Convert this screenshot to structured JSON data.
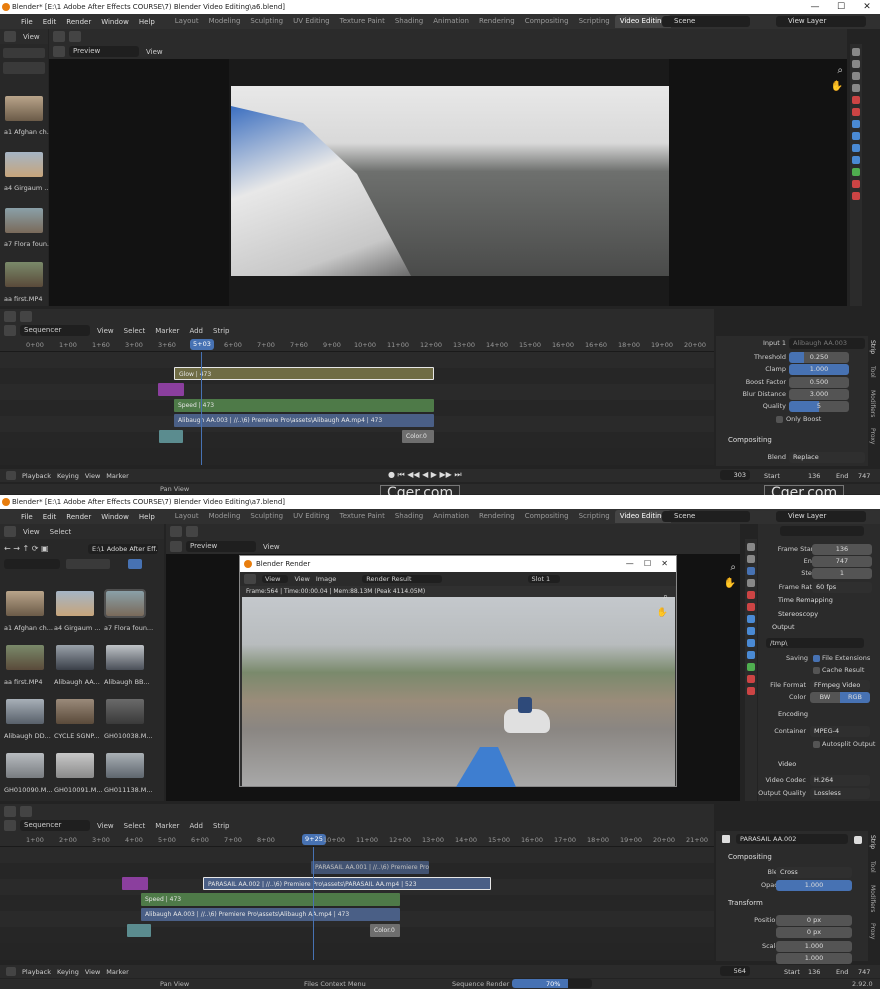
{
  "top": {
    "title": "Blender* [E:\\1 Adobe After Effects COURSE\\7) Blender Video Editing\\a6.blend]",
    "menus": [
      "File",
      "Edit",
      "Render",
      "Window",
      "Help"
    ],
    "workspaces": [
      "Layout",
      "Modeling",
      "Sculpting",
      "UV Editing",
      "Texture Paint",
      "Shading",
      "Animation",
      "Rendering",
      "Compositing",
      "Scripting",
      "Video Editing"
    ],
    "scene": "Scene",
    "view_layer": "View Layer",
    "browser_view": "View",
    "preview_mode": "Preview",
    "preview_view": "View",
    "files": [
      {
        "name": "a1 Afghan ch..."
      },
      {
        "name": "a4 Girgaum ..."
      },
      {
        "name": "a7 Flora foun..."
      },
      {
        "name": "aa first.MP4"
      }
    ],
    "seq_label": "Sequencer",
    "seq_menus": [
      "View",
      "Select",
      "Marker",
      "Add",
      "Strip"
    ],
    "ticks": [
      "0+00",
      "1+00",
      "1+60",
      "3+00",
      "3+60",
      "5+03",
      "6+00",
      "7+00",
      "7+60",
      "9+00",
      "10+00",
      "11+00",
      "12+00",
      "13+00",
      "14+00",
      "15+00",
      "16+00",
      "16+60",
      "18+00",
      "19+00",
      "20+00"
    ],
    "current_frame_label": "5+03",
    "strips": {
      "glow": "Glow | 473",
      "speed": "Speed | 473",
      "video": "Alibaugh AA.003 | //..\\6) Premiere Pro\\assets\\Alibaugh AA.mp4 | 473",
      "color": "Color.0"
    },
    "props": {
      "input_label": "Input 1",
      "input_value": "Alibaugh AA.003",
      "rows": [
        {
          "label": "Threshold",
          "value": "0.250"
        },
        {
          "label": "Clamp",
          "value": "1.000"
        },
        {
          "label": "Boost Factor",
          "value": "0.500"
        },
        {
          "label": "Blur Distance",
          "value": "3.000"
        },
        {
          "label": "Quality",
          "value": "5"
        }
      ],
      "only_boost": "Only Boost",
      "compositing": "Compositing",
      "blend_label": "Blend",
      "blend_value": "Replace"
    },
    "tabs": [
      "Strip",
      "Tool",
      "Modifiers",
      "Proxy"
    ],
    "footer": {
      "playback": "Playback",
      "keying": "Keying",
      "view": "View",
      "marker": "Marker",
      "frame": "303",
      "start_label": "Start",
      "start": "136",
      "end_label": "End",
      "end": "747"
    },
    "status": {
      "left": "Pan View"
    }
  },
  "watermark": "Cger.com",
  "bottom": {
    "title": "Blender* [E:\\1 Adobe After Effects COURSE\\7) Blender Video Editing\\a7.blend]",
    "menus": [
      "File",
      "Edit",
      "Render",
      "Window",
      "Help"
    ],
    "workspaces": [
      "Layout",
      "Modeling",
      "Sculpting",
      "UV Editing",
      "Texture Paint",
      "Shading",
      "Animation",
      "Rendering",
      "Compositing",
      "Scripting",
      "Video Editing"
    ],
    "scene": "Scene",
    "view_layer": "View Layer",
    "browser_view": "View",
    "browser_select": "Select",
    "path": "E:\\1 Adobe After Eff...",
    "preview_mode": "Preview",
    "preview_view": "View",
    "files": [
      {
        "name": "a1 Afghan ch..."
      },
      {
        "name": "a4 Girgaum ..."
      },
      {
        "name": "a7 Flora foun..."
      },
      {
        "name": "aa first.MP4"
      },
      {
        "name": "Alibaugh AA..."
      },
      {
        "name": "Alibaugh BB..."
      },
      {
        "name": "Alibaugh DD..."
      },
      {
        "name": "CYCLE SGNP..."
      },
      {
        "name": "GH010038.M..."
      },
      {
        "name": "GH010090.M..."
      },
      {
        "name": "GH010091.M..."
      },
      {
        "name": "GH011138.M..."
      }
    ],
    "render": {
      "title": "Blender Render",
      "view": "View",
      "view2": "View",
      "image": "Image",
      "result": "Render Result",
      "slot": "Slot 1",
      "info": "Frame:564 | Time:00:00.04 | Mem:88.13M (Peak 4114.05M)"
    },
    "outprops": {
      "frame_start_label": "Frame Start",
      "frame_start": "136",
      "end_label": "End",
      "end": "747",
      "step_label": "Step",
      "step": "1",
      "rate_label": "Frame Rate",
      "rate": "60 fps",
      "time_remap": "Time Remapping",
      "stereo": "Stereoscopy",
      "output": "Output",
      "path": "/tmp\\",
      "saving": "Saving",
      "file_ext": "File Extensions",
      "cache": "Cache Result",
      "format_label": "File Format",
      "format": "FFmpeg Video",
      "color_label": "Color",
      "bw": "BW",
      "rgb": "RGB",
      "encoding": "Encoding",
      "container_label": "Container",
      "container": "MPEG-4",
      "autosplit": "Autosplit Output",
      "video": "Video",
      "codec_label": "Video Codec",
      "codec": "H.264",
      "quality_label": "Output Quality",
      "quality": "Lossless"
    },
    "seq_label": "Sequencer",
    "seq_menus": [
      "View",
      "Select",
      "Marker",
      "Add",
      "Strip"
    ],
    "ticks": [
      "1+00",
      "2+00",
      "3+00",
      "4+00",
      "5+00",
      "6+00",
      "7+00",
      "8+00",
      "9+25",
      "10+00",
      "11+00",
      "12+00",
      "13+00",
      "14+00",
      "15+00",
      "16+00",
      "17+00",
      "18+00",
      "19+00",
      "20+00",
      "21+00"
    ],
    "current_frame_label": "9+25",
    "strips": {
      "parasail1": "PARASAIL AA.001 | //..\\6) Premiere Pro",
      "parasail2": "PARASAIL AA.002 | //..\\6) Premiere Pro\\assets\\PARASAIL AA.mp4 | 523",
      "speed": "Speed | 473",
      "video": "Alibaugh AA.003 | //..\\6) Premiere Pro\\assets\\Alibaugh AA.mp4 | 473",
      "color": "Color.0"
    },
    "props": {
      "name": "PARASAIL AA.002",
      "compositing": "Compositing",
      "blend_label": "Blend",
      "blend": "Cross",
      "opacity_label": "Opacity",
      "opacity": "1.000",
      "transform": "Transform",
      "posx_label": "Position X",
      "posx": "0 px",
      "y_label": "Y",
      "posy": "0 px",
      "scalex_label": "Scale X",
      "scalex": "1.000",
      "scaley": "1.000"
    },
    "tabs": [
      "Strip",
      "Tool",
      "Modifiers",
      "Proxy"
    ],
    "footer": {
      "playback": "Playback",
      "keying": "Keying",
      "view": "View",
      "marker": "Marker",
      "frame": "564",
      "start_label": "Start",
      "start": "136",
      "end_label": "End",
      "end": "747"
    },
    "status": {
      "left": "Pan View",
      "mid": "Files Context Menu",
      "render": "Sequence Render",
      "progress": "70%",
      "version": "2.92.0"
    }
  }
}
